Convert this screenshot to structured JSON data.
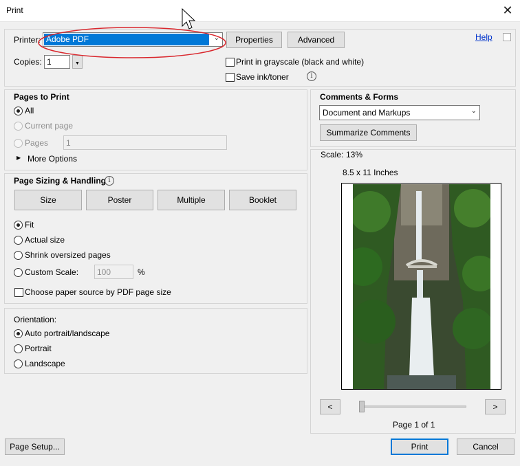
{
  "window": {
    "title": "Print",
    "close_glyph": "✕"
  },
  "printer": {
    "label": "Printer:",
    "selected": "Adobe PDF",
    "properties_label": "Properties",
    "advanced_label": "Advanced",
    "help_label": "Help"
  },
  "copies": {
    "label": "Copies:",
    "value": "1"
  },
  "options": {
    "grayscale_label": "Print in grayscale (black and white)",
    "save_ink_label": "Save ink/toner"
  },
  "pages_to_print": {
    "heading": "Pages to Print",
    "all_label": "All",
    "current_label": "Current page",
    "pages_label": "Pages",
    "pages_value": "1",
    "more_options_label": "More Options"
  },
  "sizing": {
    "heading": "Page Sizing & Handling",
    "tabs": [
      "Size",
      "Poster",
      "Multiple",
      "Booklet"
    ],
    "fit_label": "Fit",
    "actual_label": "Actual size",
    "shrink_label": "Shrink oversized pages",
    "custom_label": "Custom Scale:",
    "custom_value": "100",
    "percent": "%",
    "paper_source_label": "Choose paper source by PDF page size"
  },
  "orientation": {
    "heading": "Orientation:",
    "auto_label": "Auto portrait/landscape",
    "portrait_label": "Portrait",
    "landscape_label": "Landscape"
  },
  "comments": {
    "heading": "Comments & Forms",
    "selected": "Document and Markups",
    "summarize_label": "Summarize Comments"
  },
  "preview": {
    "scale_label": "Scale:",
    "scale_value": "13%",
    "paper_size": "8.5 x 11 Inches",
    "prev_glyph": "<",
    "next_glyph": ">",
    "page_indicator": "Page 1 of 1"
  },
  "footer": {
    "page_setup_label": "Page Setup...",
    "print_label": "Print",
    "cancel_label": "Cancel"
  },
  "colors": {
    "selection": "#0078d7",
    "annotation_ellipse": "#d9262c"
  }
}
